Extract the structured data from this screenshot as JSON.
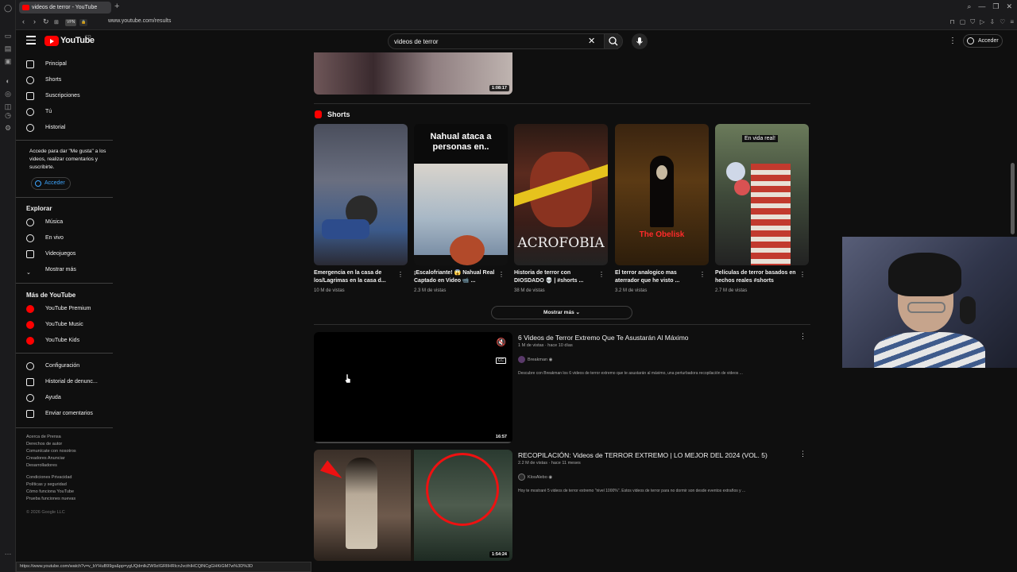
{
  "browser": {
    "tab_title": "videos de terror - YouTube",
    "url": "www.youtube.com/results",
    "status_url": "https://www.youtube.com/watch?v=v_bYHuB99gs&pp=ygUQdmlkZW9zIGRlIHRlcnJvcthlHCQlNCgGHKiGM7w%3D%3D"
  },
  "masthead": {
    "logo_text": "YouTube",
    "country_code": "CO",
    "search_value": "videos de terror",
    "signin_label": "Acceder"
  },
  "sidebar": {
    "main_items": [
      {
        "label": "Principal",
        "icon": "home-icon"
      },
      {
        "label": "Shorts",
        "icon": "shorts-icon"
      },
      {
        "label": "Suscripciones",
        "icon": "subscriptions-icon"
      },
      {
        "label": "Tú",
        "icon": "you-icon"
      },
      {
        "label": "Historial",
        "icon": "history-icon"
      }
    ],
    "login_message": "Accede para dar \"Me gusta\" a los videos, realizar comentarios y suscribirte.",
    "login_button": "Acceder",
    "explore_heading": "Explorar",
    "explore_items": [
      {
        "label": "Música",
        "icon": "music-icon"
      },
      {
        "label": "En vivo",
        "icon": "live-icon"
      },
      {
        "label": "Videojuegos",
        "icon": "gaming-icon"
      },
      {
        "label": "Mostrar más",
        "icon": "chevron-down-icon"
      }
    ],
    "more_heading": "Más de YouTube",
    "more_items": [
      {
        "label": "YouTube Premium",
        "icon": "youtube-premium-icon"
      },
      {
        "label": "YouTube Music",
        "icon": "youtube-music-icon"
      },
      {
        "label": "YouTube Kids",
        "icon": "youtube-kids-icon"
      }
    ],
    "settings_items": [
      {
        "label": "Configuración",
        "icon": "gear-icon"
      },
      {
        "label": "Historial de denunc...",
        "icon": "flag-icon"
      },
      {
        "label": "Ayuda",
        "icon": "help-icon"
      },
      {
        "label": "Enviar comentarios",
        "icon": "feedback-icon"
      }
    ],
    "footer_lines": [
      "Acerca de  Prensa",
      "Derechos de autor",
      "Comunícate con nosotros",
      "Creadores  Anunciar",
      "Desarrolladores",
      "Condiciones  Privacidad",
      "Políticas y seguridad",
      "Cómo funciona YouTube",
      "Prueba funciones nuevas"
    ],
    "copyright": "© 2026 Google LLC"
  },
  "top_video": {
    "duration": "1:08:17"
  },
  "shorts": {
    "heading": "Shorts",
    "items": [
      {
        "title": "Emergencia en la casa de los/Lagrimas en la casa d...",
        "views": "10 M de vistas",
        "overlay": ""
      },
      {
        "title": "¡Escalofriante! 😱 Nahual Real Captado en Video 📹 ...",
        "views": "2.3 M de vistas",
        "overlay": "Nahual ataca a personas en.."
      },
      {
        "title": "Historia de terror con DIOSDADO 💀 | #shorts ...",
        "views": "38 M de vistas",
        "overlay": "ACROFOBIA"
      },
      {
        "title": "El terror analogico mas aterrador que he visto ...",
        "views": "3.2 M de vistas",
        "overlay": "The Obelisk"
      },
      {
        "title": "Películas de terror basados en hechos reales #shorts",
        "views": "2.7 M de vistas",
        "overlay": "En vida real!"
      }
    ],
    "show_more": "Mostrar más"
  },
  "videos": [
    {
      "title": "6 Videos de Terror Extremo Que Te Asustarán Al Máximo",
      "meta": "1 M de vistas · hace 10 días",
      "channel": "Breakman",
      "description": "Descubre con Breakman los 6 videos de terror extremo que te asustarán al máximo, una perturbadora recopilación de videos ...",
      "duration": "16:57",
      "cc_label": "CC"
    },
    {
      "title": "RECOPILACIÓN: Videos de TERROR EXTREMO | LO MEJOR DEL 2024 (VOL. 5)",
      "meta": "2.2 M de vistas · hace 11 meses",
      "channel": "KlosAlebo",
      "description": "Hoy te mostraré 5 videos de terror extremo \"nivel 1000%\". Estos videos de terror para no dormir son desde eventos extraños y ...",
      "duration": "1:54:24"
    }
  ],
  "colors": {
    "background": "#0f0f0f",
    "brand_red": "#ff0000",
    "link_blue": "#3ea6ff",
    "secondary_text": "#aaaaaa"
  }
}
